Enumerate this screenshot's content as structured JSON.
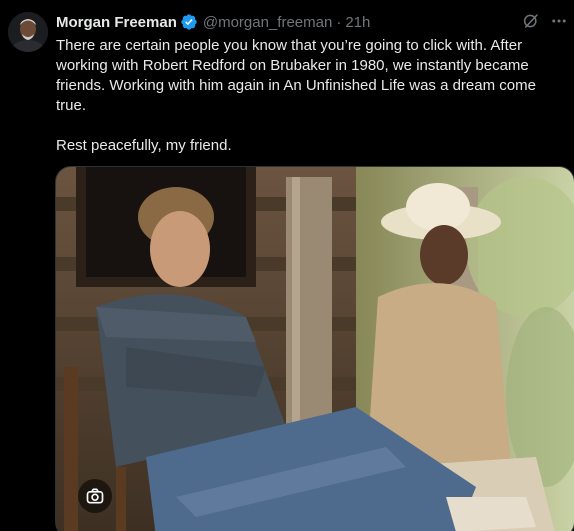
{
  "author": {
    "display_name": "Morgan Freeman",
    "handle": "@morgan_freeman",
    "separator": "·",
    "time": "21h",
    "verified": true
  },
  "tweet": {
    "paragraphs": [
      "There are certain people you know that you’re going to click with. After working with Robert Redford on Brubaker in 1980, we instantly became friends. Working with him again in An Unfinished Life was a dream come true.",
      "Rest peacefully, my friend."
    ]
  },
  "icons": {
    "verified": "verified-badge-icon",
    "grok": "grok-icon",
    "more": "more-options-icon",
    "media_action": "camera-edit-icon"
  },
  "colors": {
    "background": "#000000",
    "text_primary": "#e7e9ea",
    "text_secondary": "#71767b",
    "verified_blue": "#1d9bf0",
    "border": "#2f3336"
  }
}
